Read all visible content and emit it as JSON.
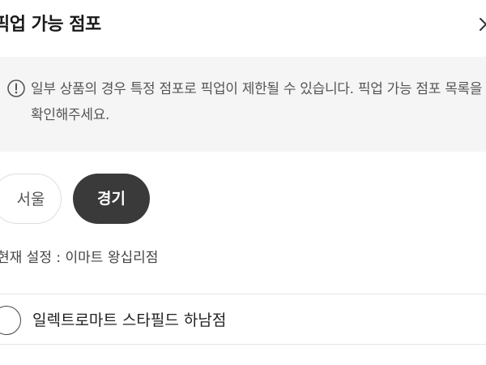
{
  "header": {
    "title": "픽업 가능 점포",
    "close_icon": "close-icon"
  },
  "notice": {
    "icon": "info-circle-icon",
    "text": "일부 상품의 경우 특정 점포로 픽업이 제한될 수 있습니다. 픽업 가능 점포 목록을 확인해주세요."
  },
  "regions": {
    "items": [
      {
        "label": "서울",
        "selected": false
      },
      {
        "label": "경기",
        "selected": true
      }
    ]
  },
  "current_store": "현재 설정 : 이마트 왕십리점",
  "stores": [
    {
      "label": "일렉트로마트 스타필드 하남점",
      "selected": false
    }
  ],
  "colors": {
    "selected_chip": "#3a3a3a",
    "notice_bg": "#f5f5f5",
    "divider": "#e4e4e4"
  }
}
